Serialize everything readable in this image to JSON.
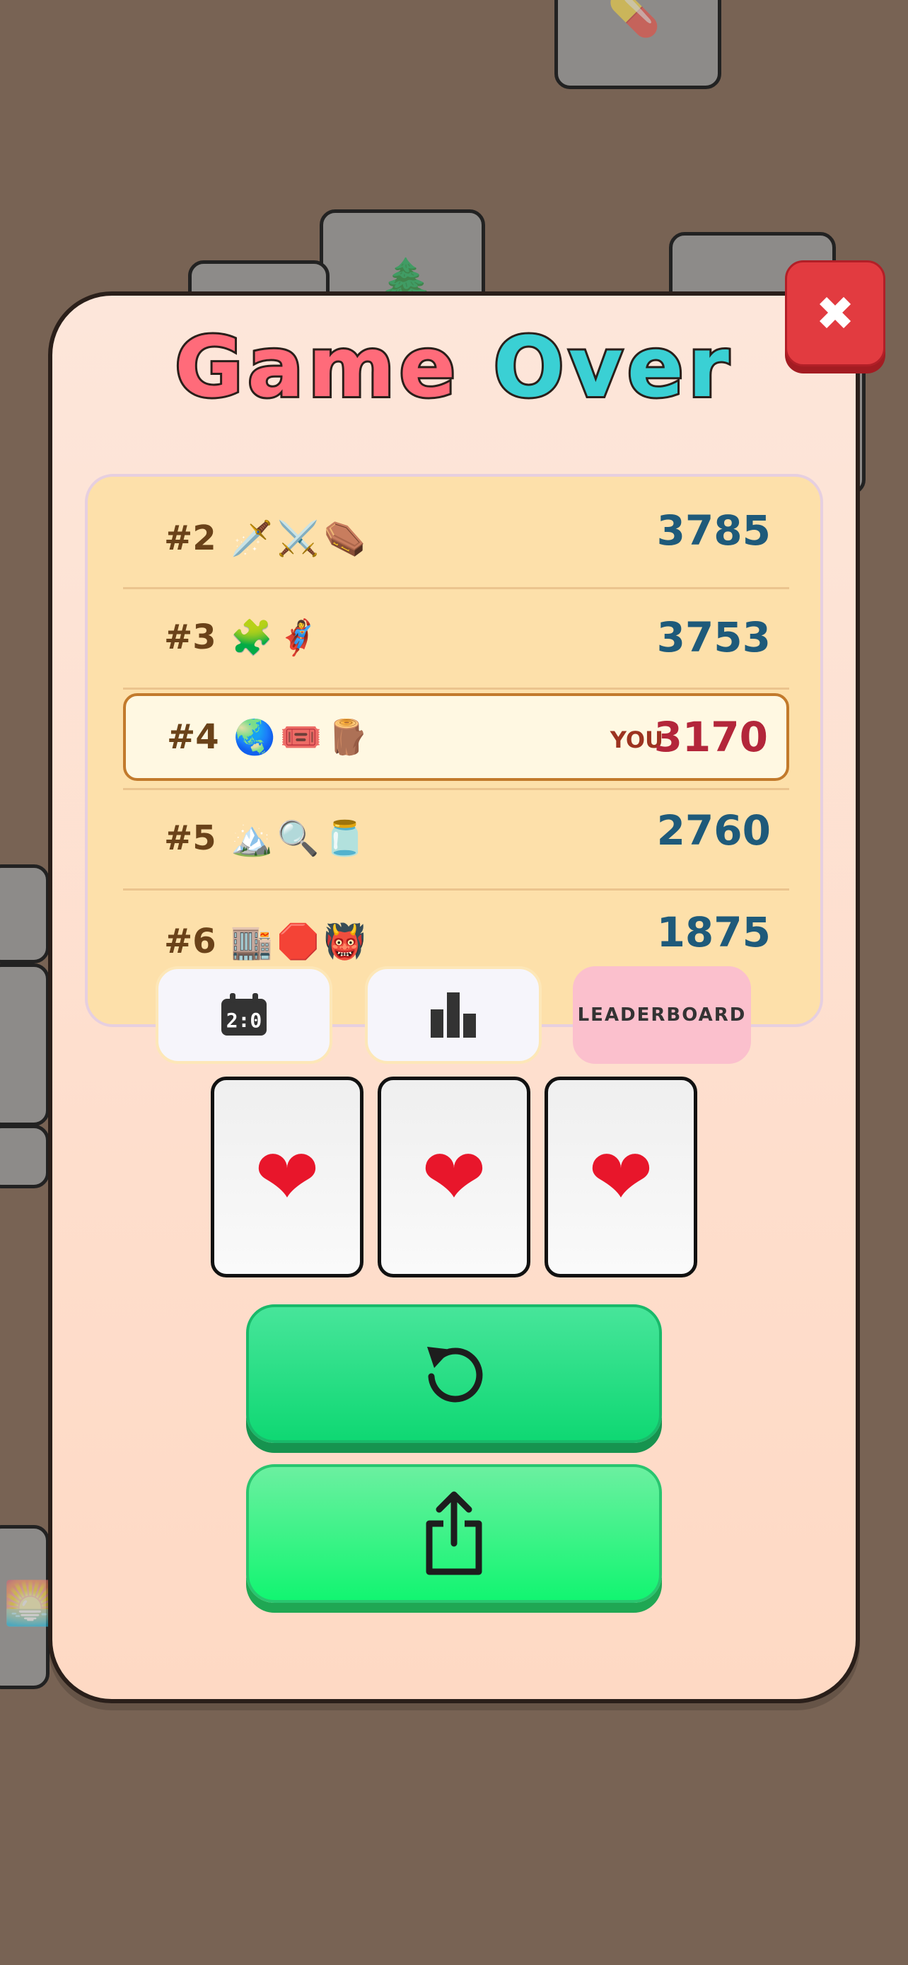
{
  "title": {
    "part1": "Game",
    "part2": "Over"
  },
  "close_label": "✖",
  "leaderboard": [
    {
      "rank": "#2",
      "emojis": "🗡️⚔️⚰️",
      "score": "3785",
      "you": ""
    },
    {
      "rank": "#3",
      "emojis": "🧩🦸‍♀️",
      "score": "3753",
      "you": ""
    },
    {
      "rank": "#4",
      "emojis": "🌏🎟️🪵",
      "score": "3170",
      "you": "YOU"
    },
    {
      "rank": "#5",
      "emojis": "🏔️🔍🫙",
      "score": "2760",
      "you": ""
    },
    {
      "rank": "#6",
      "emojis": "🏬🛑👹",
      "score": "1875",
      "you": ""
    }
  ],
  "tabs": {
    "daily_icon": "calendar-icon",
    "stats_icon": "bar-chart-icon",
    "leaderboard_label": "LEADERBOARD"
  },
  "lives": [
    "❤",
    "❤",
    "❤"
  ],
  "buttons": {
    "retry_icon": "restart-icon",
    "share_icon": "share-icon"
  },
  "colors": {
    "accent_red": "#e23b40",
    "score_blue": "#1e5a7a",
    "my_score_red": "#b3263a",
    "retry_green": "#0fd873",
    "share_green": "#12f571"
  }
}
